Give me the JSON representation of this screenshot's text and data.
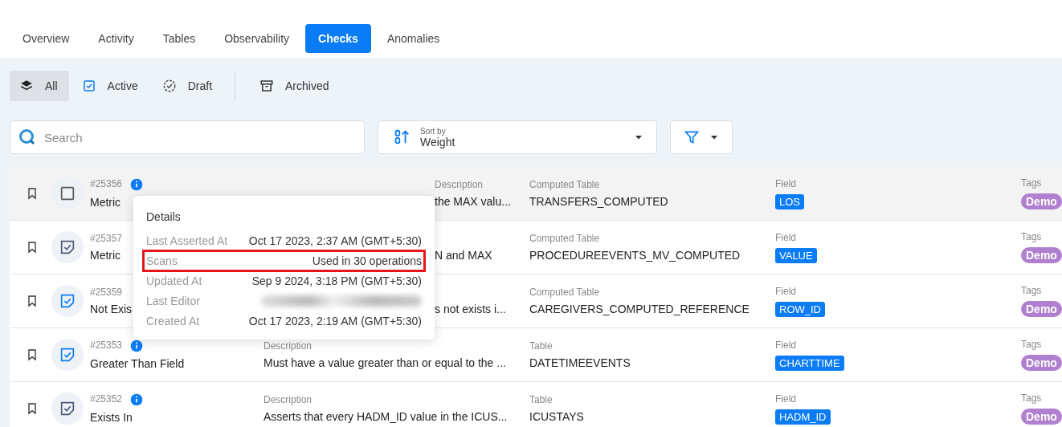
{
  "tabs": [
    {
      "label": "Overview",
      "selected": false
    },
    {
      "label": "Activity",
      "selected": false
    },
    {
      "label": "Tables",
      "selected": false
    },
    {
      "label": "Observability",
      "selected": false
    },
    {
      "label": "Checks",
      "selected": true
    },
    {
      "label": "Anomalies",
      "selected": false
    }
  ],
  "status_filters": [
    {
      "label": "All",
      "kind": "all",
      "selected": true
    },
    {
      "label": "Active",
      "kind": "active",
      "selected": false
    },
    {
      "label": "Draft",
      "kind": "draft",
      "selected": false
    },
    {
      "label": "Archived",
      "kind": "archived",
      "selected": false
    }
  ],
  "search": {
    "placeholder": "Search"
  },
  "sort": {
    "label": "Sort by",
    "value": "Weight"
  },
  "checks": [
    {
      "id": "#25356",
      "name": "Metric",
      "info": true,
      "kind": "unchecked",
      "hovered": true,
      "description_label": "Description",
      "description": "the MAX valu...",
      "description_clipped": true,
      "table_label": "Computed Table",
      "table": "TRANSFERS_COMPUTED",
      "field_label": "Field",
      "field": "LOS",
      "tags_label": "Tags",
      "tag": "Demo"
    },
    {
      "id": "#25357",
      "name": "Metric",
      "info": false,
      "kind": "muted",
      "hovered": false,
      "description": "N and MAX",
      "description_clipped": true,
      "table_label": "Computed Table",
      "table": "PROCEDUREEVENTS_MV_COMPUTED",
      "field_label": "Field",
      "field": "VALUE",
      "tags_label": "Tags",
      "tag": "Demo"
    },
    {
      "id": "#25359",
      "name": "Not Exis",
      "info": false,
      "kind": "active",
      "hovered": false,
      "description": "s not exists i...",
      "description_clipped": true,
      "table_label": "Computed Table",
      "table": "CAREGIVERS_COMPUTED_REFERENCE",
      "field_label": "Field",
      "field": "ROW_ID",
      "tags_label": "Tags",
      "tag": "Demo"
    },
    {
      "id": "#25353",
      "name": "Greater Than Field",
      "info": true,
      "kind": "active",
      "hovered": false,
      "description_label": "Description",
      "description": "Must have a value greater than or equal to the ...",
      "description_clipped": false,
      "table_label": "Table",
      "table": "DATETIMEEVENTS",
      "field_label": "Field",
      "field": "CHARTTIME",
      "tags_label": "Tags",
      "tag": "Demo"
    },
    {
      "id": "#25352",
      "name": "Exists In",
      "info": true,
      "kind": "muted",
      "hovered": false,
      "description_label": "Description",
      "description": "Asserts that every HADM_ID value in the ICUS...",
      "description_clipped": false,
      "table_label": "Table",
      "table": "ICUSTAYS",
      "field_label": "Field",
      "field": "HADM_ID",
      "tags_label": "Tags",
      "tag": "Demo"
    }
  ],
  "details_popup": {
    "title": "Details",
    "rows": [
      {
        "label": "Last Asserted At",
        "value": "Oct 17 2023, 2:37 AM (GMT+5:30)",
        "highlighted": false,
        "redacted": false
      },
      {
        "label": "Scans",
        "value": "Used in 30 operations",
        "highlighted": true,
        "redacted": false
      },
      {
        "label": "Updated At",
        "value": "Sep 9 2024, 3:18 PM (GMT+5:30)",
        "highlighted": false,
        "redacted": false
      },
      {
        "label": "Last Editor",
        "highlighted": false,
        "redacted": true
      },
      {
        "label": "Created At",
        "value": "Oct 17 2023, 2:19 AM (GMT+5:30)",
        "highlighted": false,
        "redacted": false
      }
    ]
  }
}
